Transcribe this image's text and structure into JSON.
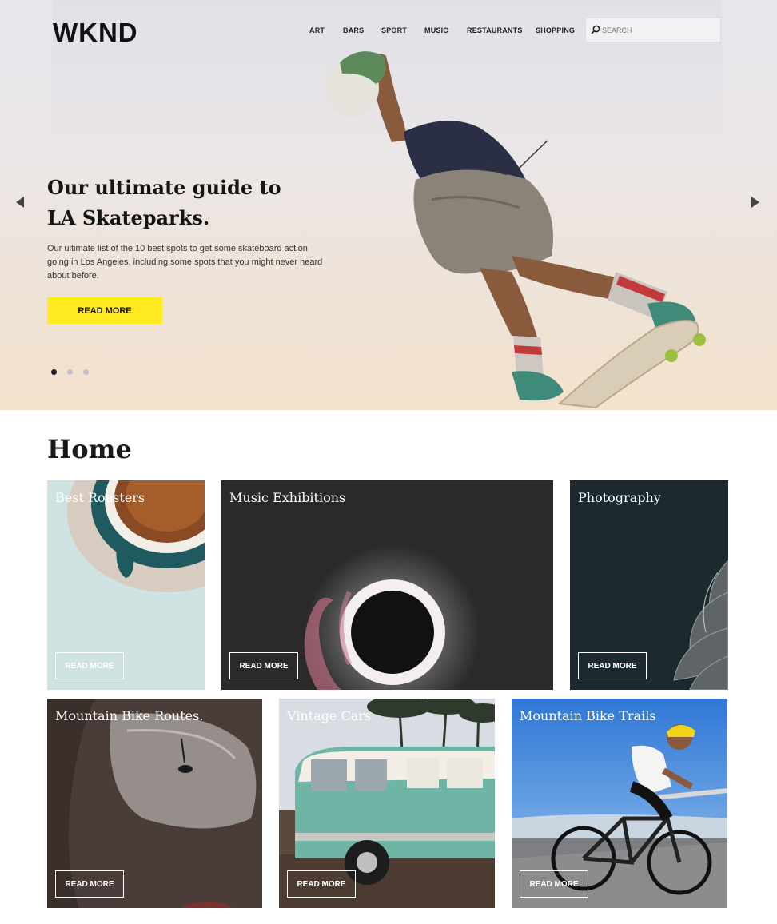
{
  "header": {
    "logo": "WKND",
    "nav": [
      {
        "label": "ART"
      },
      {
        "label": "BARS"
      },
      {
        "label": "SPORT"
      },
      {
        "label": "MUSIC"
      },
      {
        "label": "RESTAURANTS"
      },
      {
        "label": "SHOPPING"
      }
    ],
    "search": {
      "placeholder": "SEARCH",
      "icon": "search-icon"
    }
  },
  "hero": {
    "title": "Our ultimate guide to LA Skateparks.",
    "description": "Our ultimate list of the 10 best spots to get some skateboard action going in Los Angeles, including some spots that you might never heard about before.",
    "button_label": "READ MORE",
    "button_color": "#ffea1f",
    "prev_icon": "chevron-left-icon",
    "next_icon": "chevron-right-icon",
    "slide_count": 3,
    "active_slide": 1
  },
  "home": {
    "title": "Home",
    "cards": [
      {
        "title": "Best Roasters",
        "button": "READ MORE"
      },
      {
        "title": "Music Exhibitions",
        "button": "READ MORE"
      },
      {
        "title": "Photography",
        "button": "READ MORE"
      },
      {
        "title": "Mountain Bike Routes.",
        "button": "READ MORE"
      },
      {
        "title": "Vintage Cars",
        "button": "READ MORE"
      },
      {
        "title": "Mountain Bike Trails",
        "button": "READ MORE"
      }
    ]
  }
}
